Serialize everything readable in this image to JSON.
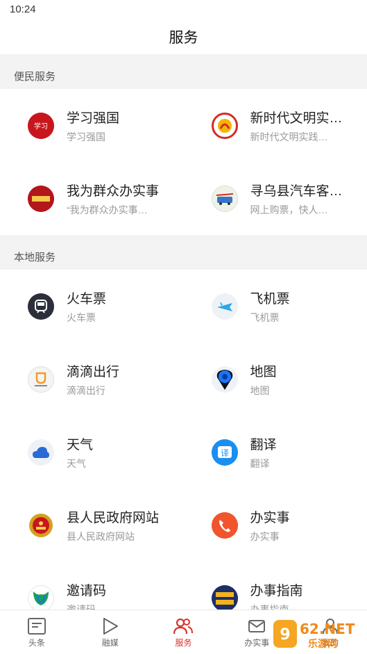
{
  "status": {
    "time": "10:24"
  },
  "page": {
    "title": "服务"
  },
  "sections": [
    {
      "label": "便民服务",
      "items": [
        {
          "title": "学习强国",
          "sub": "学习强国",
          "icon": "xuexi-qiangguo-icon"
        },
        {
          "title": "新时代文明实…",
          "sub": "新时代文明实践…",
          "icon": "civilization-icon"
        },
        {
          "title": "我为群众办实事",
          "sub": "“我为群众办实事…",
          "icon": "serve-people-icon"
        },
        {
          "title": "寻乌县汽车客…",
          "sub": "网上购票，快人…",
          "icon": "bus-station-icon"
        }
      ]
    },
    {
      "label": "本地服务",
      "items": [
        {
          "title": "火车票",
          "sub": "火车票",
          "icon": "train-icon"
        },
        {
          "title": "飞机票",
          "sub": "飞机票",
          "icon": "airplane-icon"
        },
        {
          "title": "滴滴出行",
          "sub": "滴滴出行",
          "icon": "didi-icon"
        },
        {
          "title": "地图",
          "sub": "地图",
          "icon": "map-pin-icon"
        },
        {
          "title": "天气",
          "sub": "天气",
          "icon": "cloud-icon"
        },
        {
          "title": "翻译",
          "sub": "翻译",
          "icon": "translate-icon"
        },
        {
          "title": "县人民政府网站",
          "sub": "县人民政府网站",
          "icon": "emblem-icon"
        },
        {
          "title": "办实事",
          "sub": "办实事",
          "icon": "phone-icon"
        },
        {
          "title": "邀请码",
          "sub": "邀请码",
          "icon": "invite-icon"
        },
        {
          "title": "办事指南",
          "sub": "办事指南",
          "icon": "guide-icon"
        }
      ]
    }
  ],
  "nav": [
    {
      "label": "头条",
      "icon": "headline-icon"
    },
    {
      "label": "融媒",
      "icon": "play-icon"
    },
    {
      "label": "服务",
      "icon": "people-icon",
      "active": true
    },
    {
      "label": "办实事",
      "icon": "mail-icon"
    },
    {
      "label": "我的",
      "icon": "user-icon"
    }
  ],
  "watermark": {
    "text": "962.NET",
    "sub": "乐游网"
  },
  "colors": {
    "accent": "#d9332d",
    "section_bg": "#f3f3f3",
    "subtext": "#9a9a9a"
  }
}
